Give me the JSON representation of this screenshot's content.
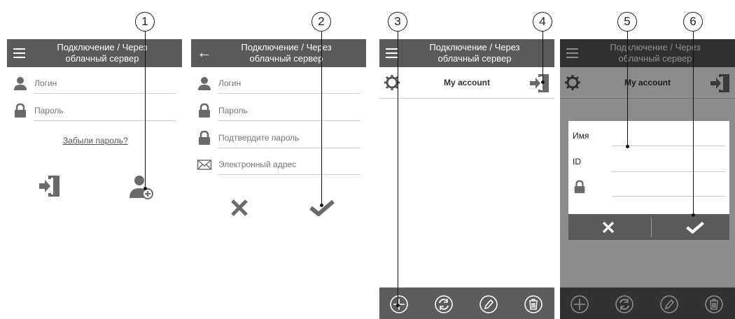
{
  "app_title": "Подключение / Через облачный сервер",
  "callouts": [
    "1",
    "2",
    "3",
    "4",
    "5",
    "6"
  ],
  "screen1": {
    "title_line1": "Подключение / Через",
    "title_line2": "облачный сервер",
    "login_label": "Логин",
    "password_label": "Пароль",
    "forgot_link": "Забыли пароль?",
    "icons": [
      "menu-icon",
      "user-icon",
      "lock-icon",
      "login-door-icon",
      "add-user-icon"
    ]
  },
  "screen2": {
    "title_line1": "Подключение / Через",
    "title_line2": "облачный сервер",
    "login_label": "Логин",
    "password_label": "Пароль",
    "confirm_label": "Подтвердите пароль",
    "email_label": "Электронный адрес",
    "icons": [
      "back-arrow-icon",
      "user-icon",
      "lock-icon",
      "envelope-icon",
      "cancel-x-icon",
      "confirm-check-icon"
    ]
  },
  "screen3": {
    "title_line1": "Подключение / Через",
    "title_line2": "облачный сервер",
    "account_label": "My account",
    "icons": [
      "menu-icon",
      "gear-icon",
      "logout-door-icon",
      "add-icon",
      "refresh-icon",
      "edit-icon",
      "delete-icon"
    ]
  },
  "screen4": {
    "title_line1": "Подключение / Через",
    "title_line2": "облачный сервер",
    "account_label": "My account",
    "name_label": "Имя",
    "id_label": "ID",
    "icons": [
      "lock-icon",
      "cancel-x-icon",
      "confirm-check-icon"
    ]
  },
  "colors": {
    "appbar": "#5a5a5a",
    "icon_gray": "#6a6a6a",
    "background": "#ffffff"
  }
}
